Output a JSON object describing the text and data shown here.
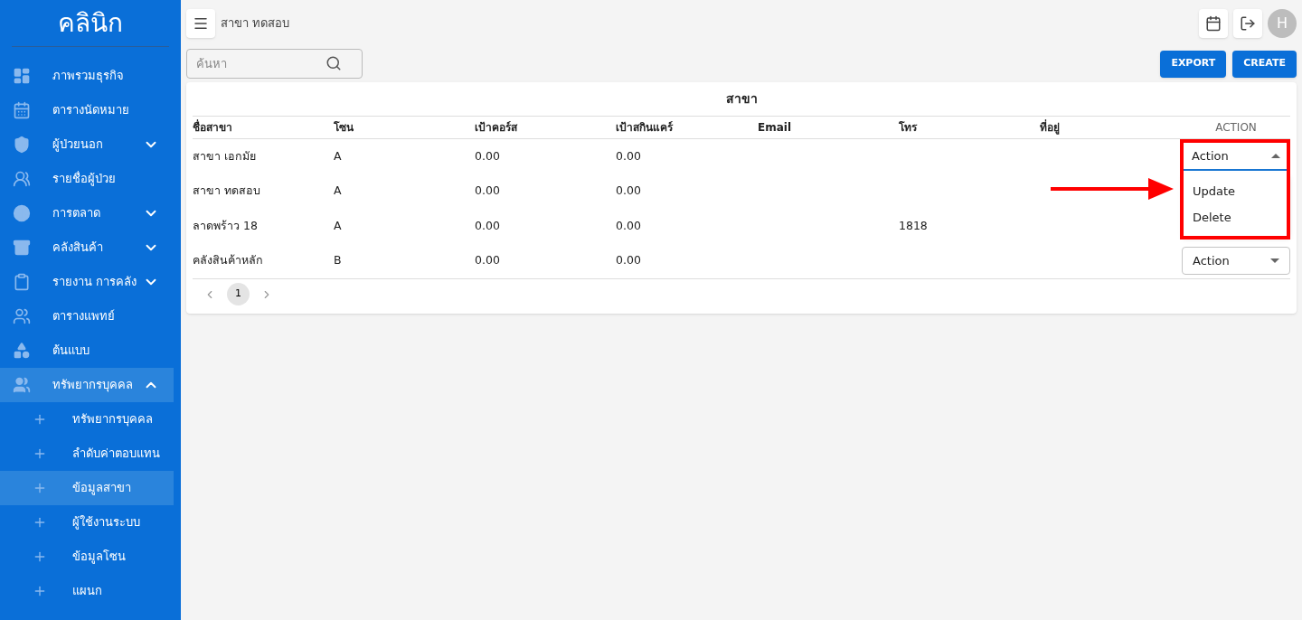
{
  "sidebar": {
    "logo": "คลินิก",
    "items": [
      {
        "label": "ภาพรวมธุรกิจ",
        "selected": false
      },
      {
        "label": "ตารางนัดหมาย",
        "selected": false
      },
      {
        "label": "ผู้ป่วยนอก",
        "selected": false,
        "expanded": false
      },
      {
        "label": "รายชื่อผู้ป่วย",
        "selected": false
      },
      {
        "label": "การตลาด",
        "selected": false,
        "expanded": false
      },
      {
        "label": "คลังสินค้า",
        "selected": false,
        "expanded": false
      },
      {
        "label": "รายงาน การคลัง",
        "selected": false,
        "expanded": false
      },
      {
        "label": "ตารางแพทย์",
        "selected": false
      },
      {
        "label": "ต้นแบบ",
        "selected": false
      },
      {
        "label": "ทรัพยากรบุคคล",
        "selected": false,
        "expanded": true,
        "children": [
          {
            "label": "ทรัพยากรบุคคล",
            "selected": false
          },
          {
            "label": "ลำดับค่าตอบแทน",
            "selected": false
          },
          {
            "label": "ข้อมูลสาขา",
            "selected": true
          },
          {
            "label": "ผู้ใช้งานระบบ",
            "selected": false
          },
          {
            "label": "ข้อมูลโซน",
            "selected": false
          },
          {
            "label": "แผนก",
            "selected": false
          }
        ]
      }
    ]
  },
  "header": {
    "breadcrumb": "สาขา ทดสอบ",
    "avatar": "H"
  },
  "search": {
    "placeholder": "ค้นหา"
  },
  "buttons": [
    "EXPORT",
    "CREATE"
  ],
  "table": {
    "title": "สาขา",
    "columns": [
      "ชื่อสาขา",
      "โซน",
      "เป้าคอร์ส",
      "เป้าสกินแคร์",
      "Email",
      "โทร",
      "ที่อยู่",
      "ACTION"
    ],
    "rows": [
      {
        "cells": [
          "สาขา เอกมัย",
          "A",
          "0.00",
          "0.00",
          "",
          "",
          "",
          ""
        ],
        "action": {
          "label": "Action",
          "expanded": true,
          "options": [
            "Update",
            "Delete"
          ]
        }
      },
      {
        "cells": [
          "สาขา ทดสอบ",
          "A",
          "0.00",
          "0.00",
          "",
          "",
          "",
          ""
        ]
      },
      {
        "cells": [
          "ลาดพร้าว 18",
          "A",
          "0.00",
          "0.00",
          "",
          "1818",
          "",
          ""
        ]
      },
      {
        "cells": [
          "คลังสินค้าหลัก",
          "B",
          "0.00",
          "0.00",
          "",
          "",
          "",
          ""
        ],
        "action": {
          "label": "Action",
          "expanded": false
        }
      }
    ],
    "pages": [
      {
        "label": "1",
        "selected": true
      }
    ]
  }
}
